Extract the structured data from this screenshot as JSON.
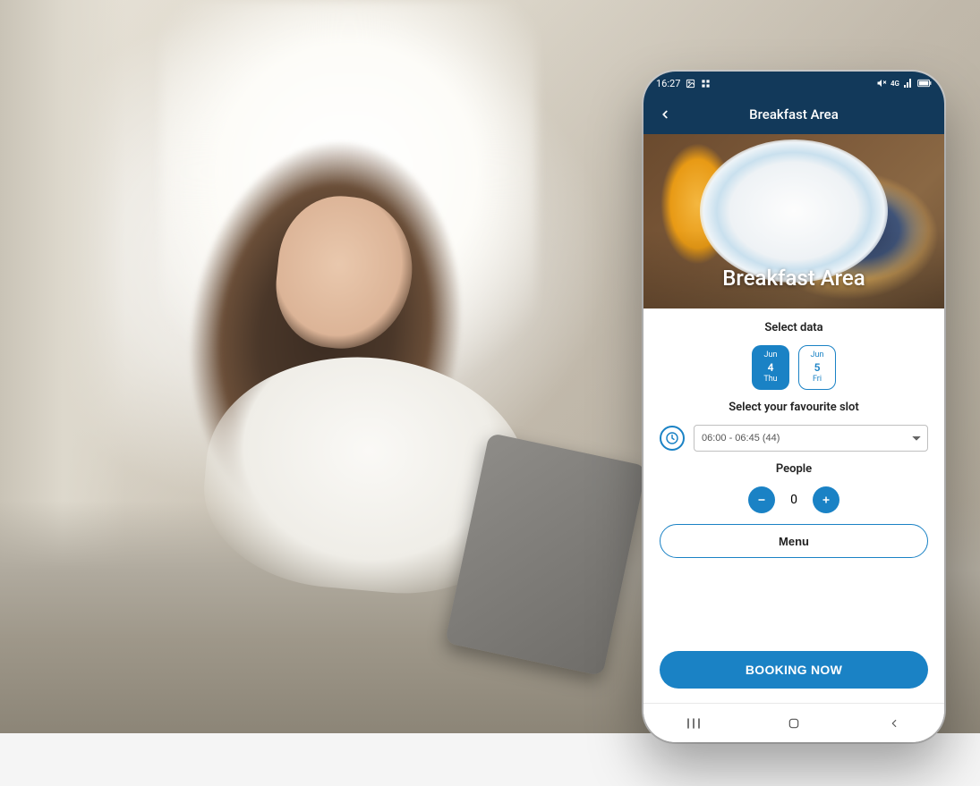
{
  "status_bar": {
    "time": "16:27",
    "icons_left": [
      "photo-icon",
      "apps-icon"
    ],
    "icons_right": [
      "mute-icon",
      "network-4g-icon",
      "signal-icon",
      "battery-icon"
    ]
  },
  "header": {
    "title": "Breakfast Area"
  },
  "hero": {
    "title": "Breakfast Area"
  },
  "form": {
    "select_date_label": "Select data",
    "dates": [
      {
        "month": "Jun",
        "day": "4",
        "weekday": "Thu",
        "selected": true
      },
      {
        "month": "Jun",
        "day": "5",
        "weekday": "Fri",
        "selected": false
      }
    ],
    "select_slot_label": "Select your favourite slot",
    "slot_value": "06:00 - 06:45 (44)",
    "people_label": "People",
    "people_count": "0",
    "menu_label": "Menu",
    "booking_label": "BOOKING NOW"
  },
  "colors": {
    "primary": "#1a82c5",
    "header_bg": "#12395a"
  }
}
